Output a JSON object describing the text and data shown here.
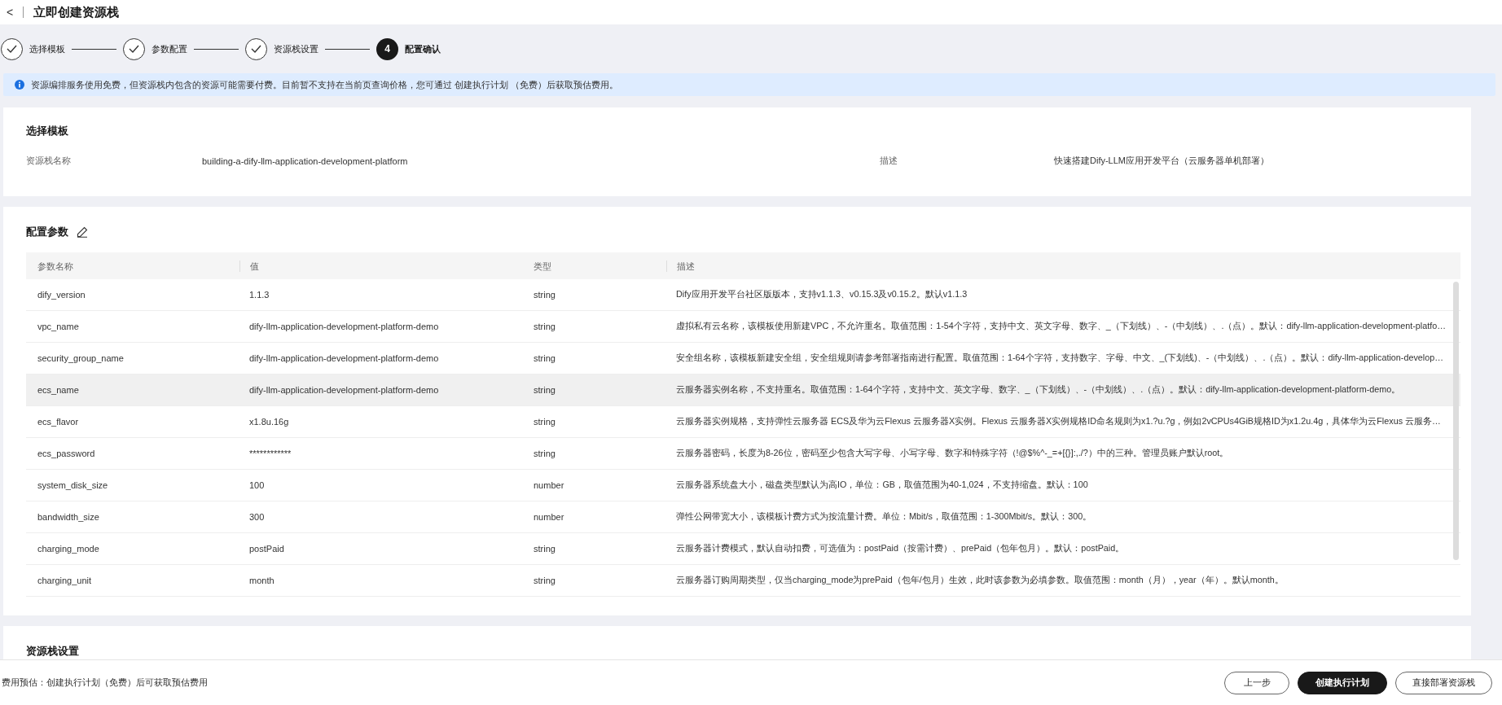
{
  "header": {
    "back": "<",
    "title": "立即创建资源栈"
  },
  "steps": [
    {
      "label": "选择模板",
      "done": true,
      "selected": false
    },
    {
      "label": "参数配置",
      "done": true,
      "selected": false
    },
    {
      "label": "资源栈设置",
      "done": true,
      "selected": false
    },
    {
      "label": "配置确认",
      "done": false,
      "selected": true,
      "number": "4"
    }
  ],
  "notice": {
    "text": "资源编排服务使用免费，但资源栈内包含的资源可能需要付费。目前暂不支持在当前页查询价格，您可通过 创建执行计划 （免费）后获取预估费用。"
  },
  "template_card": {
    "title": "选择模板",
    "fields": [
      {
        "label": "资源栈名称",
        "value": "building-a-dify-llm-application-development-platform"
      },
      {
        "label": "描述",
        "value": "快速搭建Dify-LLM应用开发平台（云服务器单机部署）"
      }
    ]
  },
  "params_card": {
    "title": "配置参数",
    "columns": [
      "参数名称",
      "值",
      "类型",
      "描述"
    ],
    "rows": [
      {
        "name": "dify_version",
        "value": "1.1.3",
        "type": "string",
        "description": "Dify应用开发平台社区版版本，支持v1.1.3、v0.15.3及v0.15.2。默认v1.1.3",
        "highlighted": false
      },
      {
        "name": "vpc_name",
        "value": "dify-llm-application-development-platform-demo",
        "type": "string",
        "description": "虚拟私有云名称，该模板使用新建VPC，不允许重名。取值范围：1-54个字符，支持中文、英文字母、数字、_（下划线）、-（中划线）、.（点）。默认：dify-llm-application-development-platfo…",
        "highlighted": false
      },
      {
        "name": "security_group_name",
        "value": "dify-llm-application-development-platform-demo",
        "type": "string",
        "description": "安全组名称，该模板新建安全组，安全组规则请参考部署指南进行配置。取值范围：1-64个字符，支持数字、字母、中文、_(下划线)、-（中划线）、.（点）。默认：dify-llm-application-develop…",
        "highlighted": false
      },
      {
        "name": "ecs_name",
        "value": "dify-llm-application-development-platform-demo",
        "type": "string",
        "description": "云服务器实例名称，不支持重名。取值范围：1-64个字符，支持中文、英文字母、数字、_（下划线）、-（中划线）、.（点）。默认：dify-llm-application-development-platform-demo。",
        "highlighted": true
      },
      {
        "name": "ecs_flavor",
        "value": "x1.8u.16g",
        "type": "string",
        "description": "云服务器实例规格，支持弹性云服务器 ECS及华为云Flexus 云服务器X实例。Flexus 云服务器X实例规格ID命名规则为x1.?u.?g，例如2vCPUs4GiB规格ID为x1.2u.4g，具体华为云Flexus 云服务…",
        "highlighted": false
      },
      {
        "name": "ecs_password",
        "value": "************",
        "type": "string",
        "description": "云服务器密码，长度为8-26位，密码至少包含大写字母、小写字母、数字和特殊字符（!@$%^-_=+[{}]:,./?）中的三种。管理员账户默认root。",
        "highlighted": false
      },
      {
        "name": "system_disk_size",
        "value": "100",
        "type": "number",
        "description": "云服务器系统盘大小，磁盘类型默认为高IO，单位：GB，取值范围为40-1,024，不支持缩盘。默认：100",
        "highlighted": false
      },
      {
        "name": "bandwidth_size",
        "value": "300",
        "type": "number",
        "description": "弹性公网带宽大小，该模板计费方式为按流量计费。单位：Mbit/s，取值范围：1-300Mbit/s。默认：300。",
        "highlighted": false
      },
      {
        "name": "charging_mode",
        "value": "postPaid",
        "type": "string",
        "description": "云服务器计费模式，默认自动扣费，可选值为：postPaid（按需计费）、prePaid（包年包月）。默认：postPaid。",
        "highlighted": false
      },
      {
        "name": "charging_unit",
        "value": "month",
        "type": "string",
        "description": "云服务器订购周期类型，仅当charging_mode为prePaid（包年/包月）生效，此时该参数为必填参数。取值范围：month（月），year（年）。默认month。",
        "highlighted": false
      }
    ]
  },
  "stack_card": {
    "title": "资源栈设置"
  },
  "footer": {
    "estimate": "费用预估：创建执行计划（免费）后可获取预估费用",
    "buttons": [
      {
        "label": "上一步",
        "kind": "outline"
      },
      {
        "label": "创建执行计划",
        "kind": "primary"
      },
      {
        "label": "直接部署资源栈",
        "kind": "outline"
      }
    ]
  }
}
